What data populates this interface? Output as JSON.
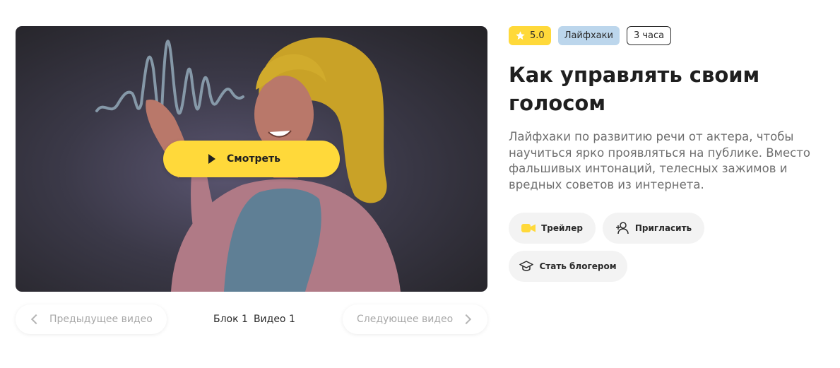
{
  "player": {
    "watch_label": "Смотреть"
  },
  "nav": {
    "prev_label": "Предыдущее видео",
    "next_label": "Следующее видео",
    "block_label": "Блок 1",
    "video_label": "Видео 1"
  },
  "course": {
    "rating": "5.0",
    "category": "Лайфхаки",
    "duration": "3 часа",
    "title": "Как управлять своим голосом",
    "description": "Лайфхаки по развитию речи от актера, чтобы научиться ярко проявляться на публике. Вместо фальшивых интонаций, телесных зажимов и вредных советов из интернета."
  },
  "actions": {
    "trailer_label": "Трейлер",
    "invite_label": "Пригласить",
    "blogger_label": "Стать блогером"
  },
  "colors": {
    "accent_yellow": "#ffd93a",
    "category_blue": "#bcd6ec",
    "button_gray": "#f3f3f3"
  },
  "icons": [
    "star-icon",
    "play-icon",
    "chevron-left-icon",
    "chevron-right-icon",
    "video-camera-icon",
    "add-user-icon",
    "graduation-cap-icon"
  ]
}
